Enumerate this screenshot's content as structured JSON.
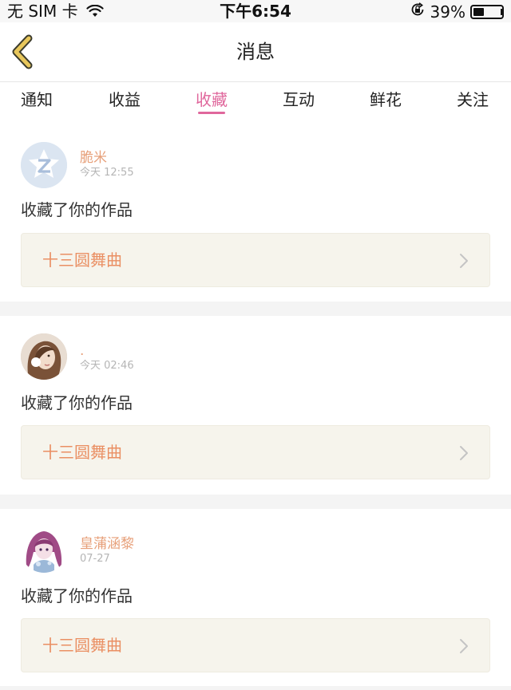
{
  "status_bar": {
    "carrier": "无 SIM 卡",
    "time": "下午6:54",
    "battery": "39%",
    "battery_level": 0.39
  },
  "nav": {
    "title": "消息"
  },
  "tabs": [
    {
      "label": "通知",
      "active": false
    },
    {
      "label": "收益",
      "active": false
    },
    {
      "label": "收藏",
      "active": true
    },
    {
      "label": "互动",
      "active": false
    },
    {
      "label": "鲜花",
      "active": false
    },
    {
      "label": "关注",
      "active": false
    }
  ],
  "messages": [
    {
      "username": "脆米",
      "time": "今天 12:55",
      "text": "收藏了你的作品",
      "work_title": "十三圆舞曲",
      "avatar": "qq-default-avatar"
    },
    {
      "username": ".",
      "time": "今天 02:46",
      "text": "收藏了你的作品",
      "work_title": "十三圆舞曲",
      "avatar": "user-photo-avatar"
    },
    {
      "username": "皇蒲涵黎",
      "time": "07-27",
      "text": "收藏了你的作品",
      "work_title": "十三圆舞曲",
      "avatar": "anime-girl-avatar"
    }
  ],
  "colors": {
    "accent": "#e0679c",
    "username": "#e7a07a",
    "work_title": "#ea8f63",
    "work_box_bg": "#f6f4ec",
    "back_chevron": "#e8c75c"
  }
}
